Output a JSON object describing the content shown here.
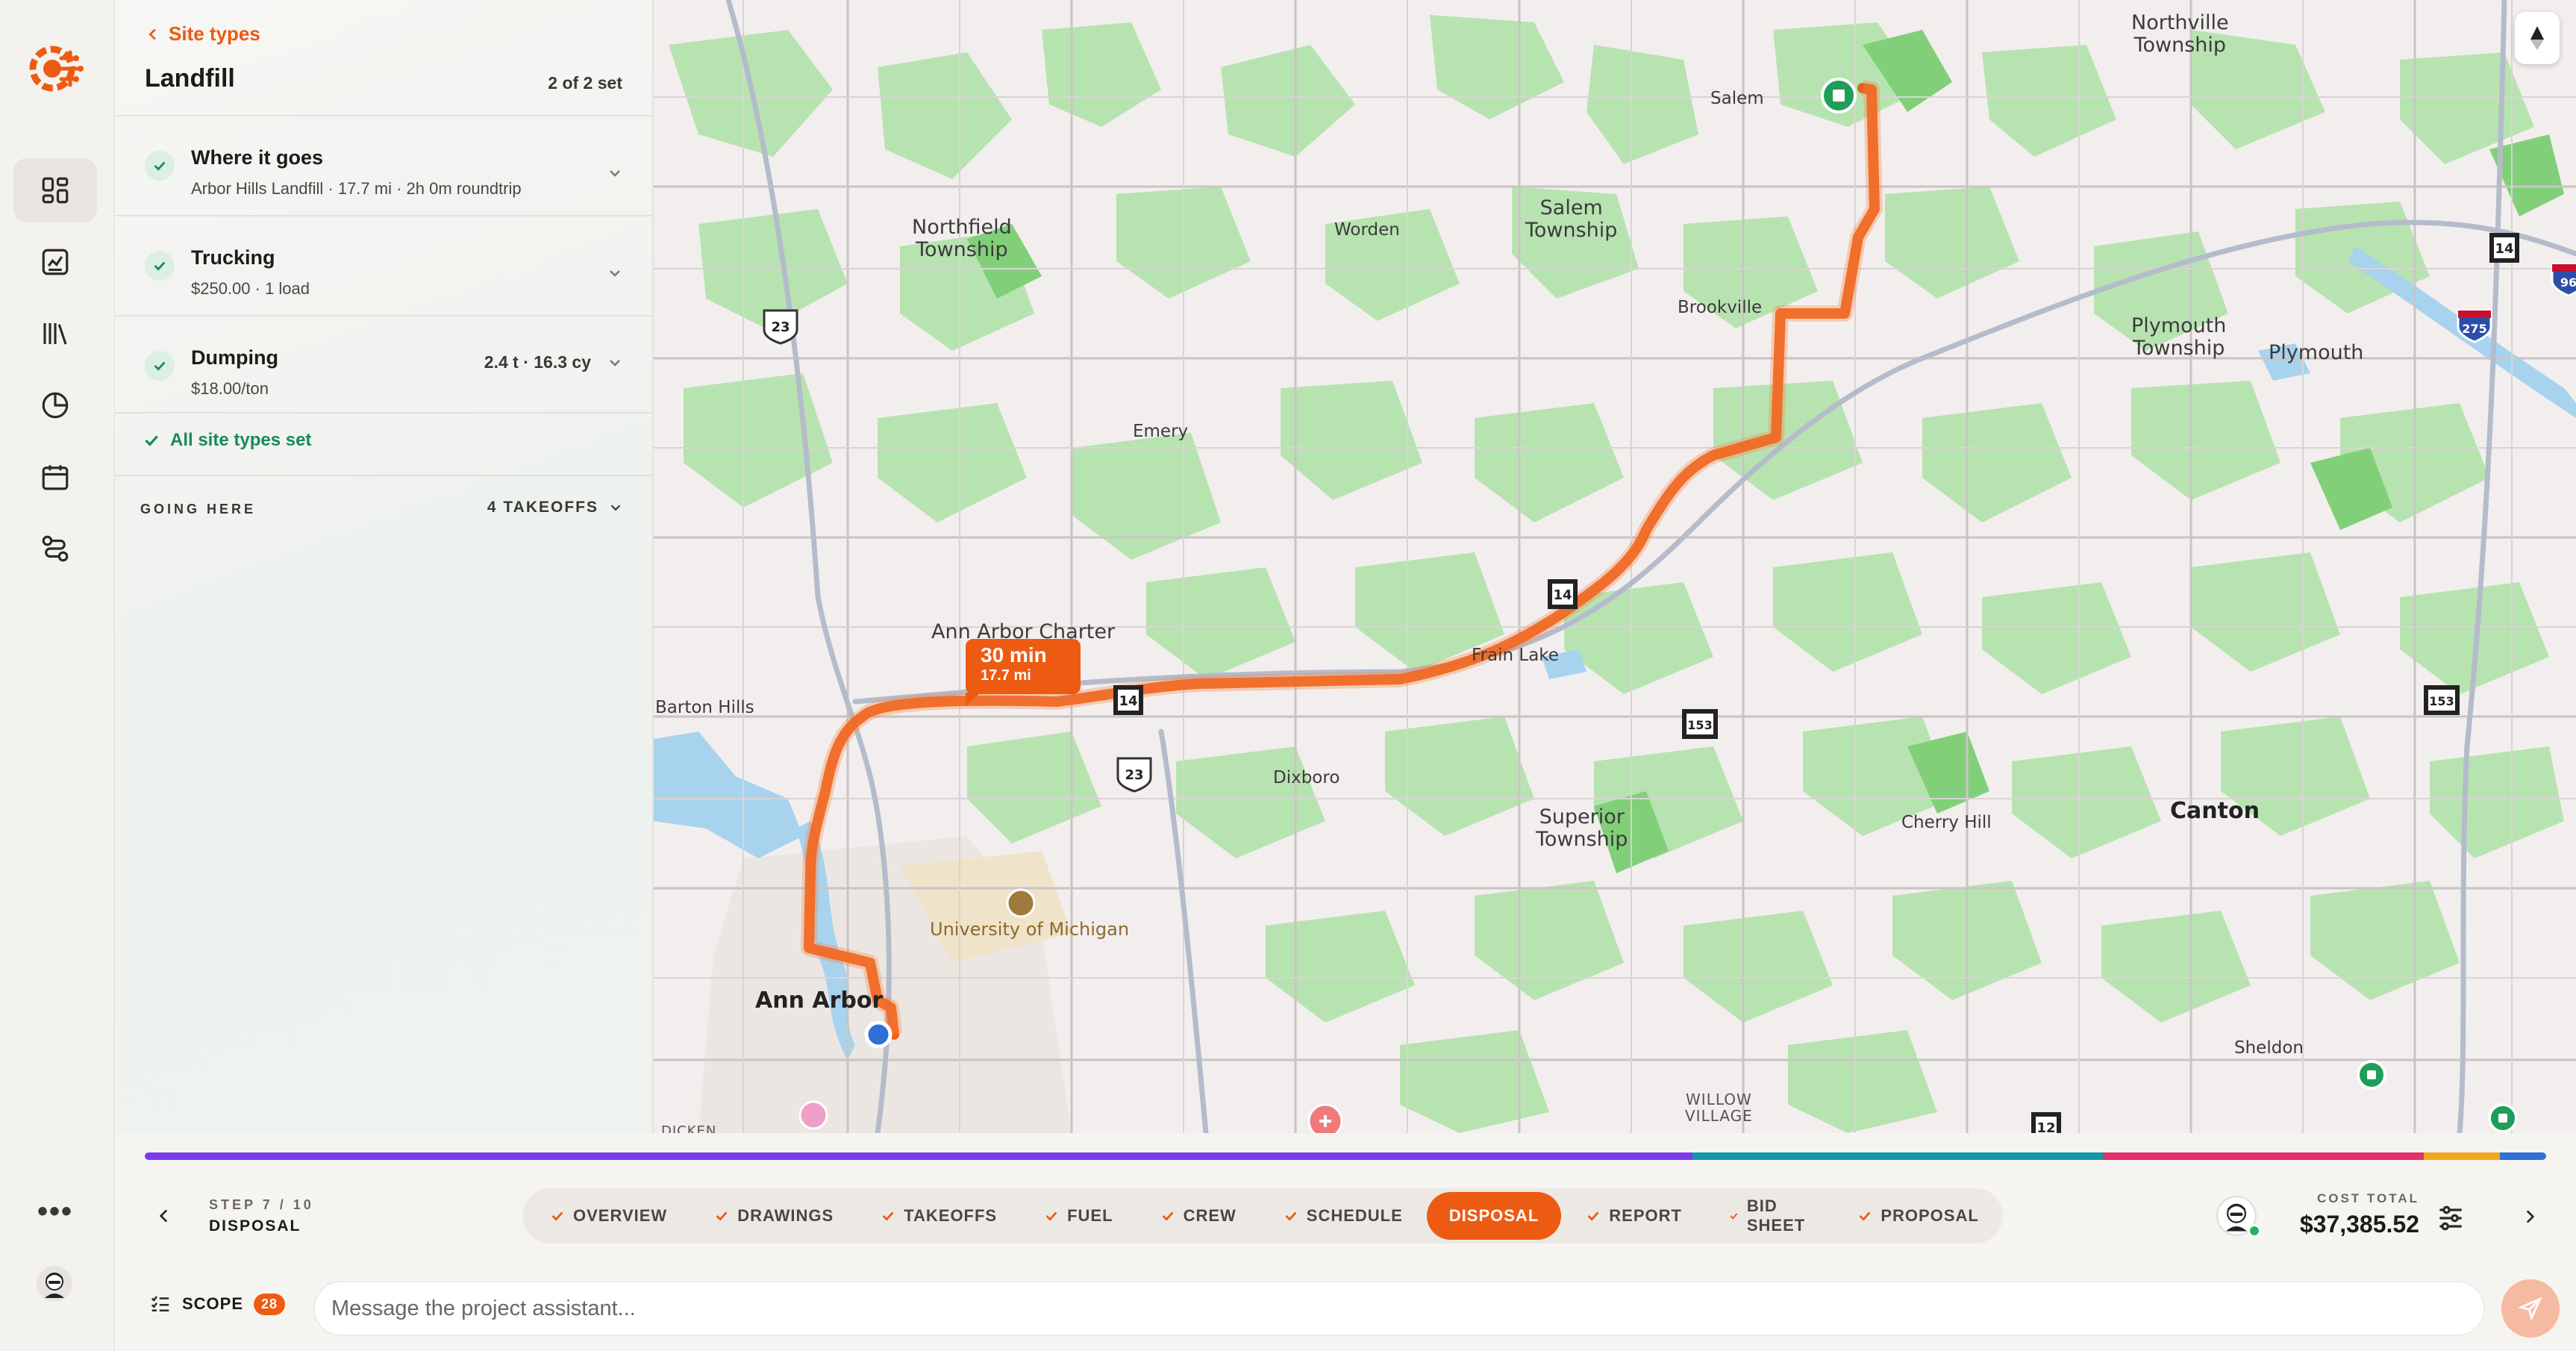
{
  "app": {
    "logo_icon": "circuit-gear-logo",
    "brand_color": "#ed5b13"
  },
  "rail": {
    "items": [
      {
        "name": "dashboard-icon",
        "active": true
      },
      {
        "name": "estimate-icon",
        "active": false
      },
      {
        "name": "library-icon",
        "active": false
      },
      {
        "name": "analytics-icon",
        "active": false
      },
      {
        "name": "calendar-icon",
        "active": false
      },
      {
        "name": "routes-icon",
        "active": false
      }
    ],
    "more_label": "•••"
  },
  "panel": {
    "back_label": "Site types",
    "title": "Landfill",
    "count": "2 of 2 set",
    "items": [
      {
        "title": "Where it goes",
        "subtitle": "Arbor Hills Landfill · 17.7 mi · 2h 0m roundtrip",
        "right": ""
      },
      {
        "title": "Trucking",
        "subtitle": "$250.00 · 1 load",
        "right": ""
      },
      {
        "title": "Dumping",
        "subtitle": "$18.00/ton",
        "right": "2.4 t · 16.3 cy"
      }
    ],
    "all_set": "All site types set",
    "going_here": "GOING HERE",
    "takeoffs": "4 TAKEOFFS"
  },
  "map": {
    "labels": {
      "northville": "Northville\nTownship",
      "salem": "Salem",
      "salem_twp": "Salem\nTownship",
      "worden": "Worden",
      "northfield": "Northfield\nTownship",
      "brookville": "Brookville",
      "plymouth_twp": "Plymouth\nTownship",
      "plymouth": "Plymouth",
      "emery": "Emery",
      "ann_arbor_charter": "Ann Arbor Charter",
      "frain_lake": "Frain Lake",
      "barton_hills": "Barton Hills",
      "dixboro": "Dixboro",
      "superior": "Superior\nTownship",
      "cherry_hill": "Cherry Hill",
      "canton": "Canton",
      "umich": "University of Michigan",
      "ann_arbor": "Ann Arbor",
      "sheldon": "Sheldon",
      "willow_village": "WILLOW\nVILLAGE",
      "dicken": "DICKEN"
    },
    "shields": {
      "us23": "23",
      "m14": "14",
      "m153": "153",
      "i275": "275",
      "m12": "12",
      "i96": "96"
    },
    "route": {
      "duration": "30 min",
      "distance": "17.7 mi",
      "color": "#ed5b13"
    }
  },
  "progress_colors": [
    "#7c3aed",
    "#1296a8",
    "#e1306c",
    "#f0a81c",
    "#2f6fd8"
  ],
  "step": {
    "counter": "STEP 7 / 10",
    "name": "DISPOSAL"
  },
  "steps": [
    {
      "label": "OVERVIEW",
      "active": false
    },
    {
      "label": "DRAWINGS",
      "active": false
    },
    {
      "label": "TAKEOFFS",
      "active": false
    },
    {
      "label": "FUEL",
      "active": false
    },
    {
      "label": "CREW",
      "active": false
    },
    {
      "label": "SCHEDULE",
      "active": false
    },
    {
      "label": "DISPOSAL",
      "active": true
    },
    {
      "label": "REPORT",
      "active": false
    },
    {
      "label": "BID SHEET",
      "active": false
    },
    {
      "label": "PROPOSAL",
      "active": false
    }
  ],
  "cost": {
    "label": "COST TOTAL",
    "value": "$37,385.52"
  },
  "scope": {
    "label": "SCOPE",
    "count": "28"
  },
  "message": {
    "placeholder": "Message the project assistant..."
  }
}
